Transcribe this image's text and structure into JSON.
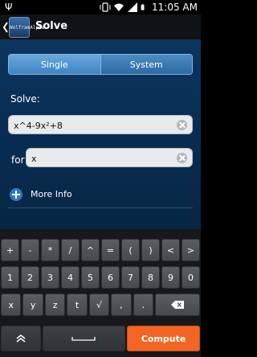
{
  "status_bar": {
    "usb_icon": "usb-icon",
    "time": "11:05 AM"
  },
  "action_bar": {
    "title": "Solve",
    "logo_text": "WolframAlpha"
  },
  "mode_tabs": [
    {
      "label": "Single",
      "active": true
    },
    {
      "label": "System",
      "active": false
    }
  ],
  "solve": {
    "label": "Solve:",
    "equation_value": "x^4-9x²+8",
    "for_label": "for",
    "variable_value": "x"
  },
  "more_info": {
    "label": "More Info"
  },
  "keyboard": {
    "row1": [
      "+",
      "-",
      "*",
      "/",
      "^",
      "=",
      "(",
      ")",
      "<",
      ">"
    ],
    "row2": [
      "1",
      "2",
      "3",
      "4",
      "5",
      "6",
      "7",
      "8",
      "9",
      "0"
    ],
    "row3": [
      "x",
      "y",
      "z",
      "t",
      "√",
      ",",
      "."
    ],
    "compute_label": "Compute"
  },
  "colors": {
    "accent": "#f26522",
    "blue": "#2f79c4"
  }
}
